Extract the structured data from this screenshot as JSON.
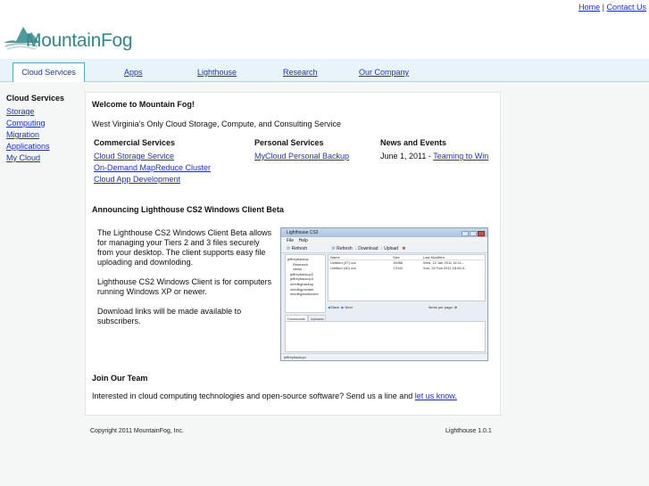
{
  "toplinks": {
    "home": "Home",
    "sep": "|",
    "contact": "Contact Us"
  },
  "logo": {
    "text": "MountainFog",
    "brand_color": "#2f8a8a"
  },
  "nav": {
    "tabs": [
      {
        "label": "Cloud Services",
        "active": true
      },
      {
        "label": "Apps"
      },
      {
        "label": "Lighthouse"
      },
      {
        "label": "Research"
      },
      {
        "label": "Our Company"
      }
    ]
  },
  "sidebar": {
    "heading": "Cloud Services",
    "items": [
      "Storage",
      "Computing",
      "Migration",
      "Applications",
      "My Cloud"
    ]
  },
  "main": {
    "welcome": "Welcome to Mountain Fog!",
    "tagline": "West Virginia's Only Cloud Storage, Compute, and Consulting Service",
    "commercial": {
      "heading": "Commercial Services",
      "links": [
        "Cloud Storage Service",
        "On-Demand MapReduce Cluster",
        "Cloud App Development"
      ]
    },
    "personal": {
      "heading": "Personal Services",
      "links": [
        "MyCloud Personal Backup"
      ]
    },
    "news": {
      "heading": "News and Events",
      "date": "June 1, 2011 - ",
      "link": "Teaming to Win"
    },
    "announce": {
      "heading": "Announcing Lighthouse CS2 Windows Client Beta",
      "p1": "The Lighthouse CS2 Windows Client Beta allows for managing your Tiers 2 and 3 files securely from your desktop. The client supports easy file uploading and downloding.",
      "p2": "Lighthouse CS2 Windows Client is for computers running Windows XP or newer.",
      "p3": "Download links will be made available to subscribers."
    },
    "screenshot": {
      "title": "Lighthouse CS2",
      "menu_file": "File",
      "menu_help": "Help",
      "tool_refresh": "Refresh",
      "tool_refresh2": "Refresh",
      "tool_download": "Download",
      "tool_upload": "Upload",
      "tree": [
        "jeffreybackup",
        "Research",
        "views",
        "jeffreybackup2",
        "jeffreybackup3",
        "mbnfbgbackup",
        "mbnfbgprivatet",
        "mbnfbgtestbucket"
      ],
      "columns": {
        "name": "Name",
        "size": "Size",
        "modified": "Last Modified"
      },
      "rows": [
        {
          "name": "Untitled (37).vcz",
          "size": "15086",
          "modified": "Wed, 12 Jan 2011 16:11..."
        },
        {
          "name": "Untitled (40).vcz",
          "size": "17042",
          "modified": "Sun, 20 Feb 2011 18:06:3..."
        }
      ],
      "back": "Back",
      "next": "Next",
      "items_per_page": "Items per page: 2",
      "tab_downloads": "Downloads",
      "tab_uploads": "Uploads",
      "status": "jeffreybackup/"
    },
    "join": {
      "heading": "Join Our Team",
      "text": "Interested in cloud computing technologies and open-source software? Send us a line and ",
      "link": "let us know."
    }
  },
  "footer": {
    "copyright": "Copyright 2011 MountainFog, Inc.",
    "version": "Lighthouse 1.0.1"
  }
}
